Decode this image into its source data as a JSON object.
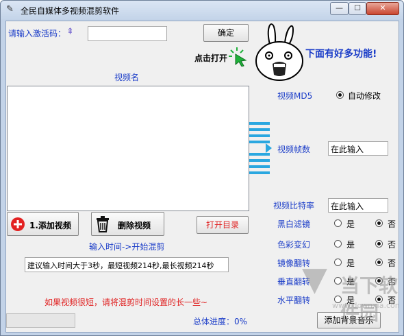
{
  "window": {
    "title": "全民自媒体多视频混剪软件",
    "min": "0",
    "max": "1",
    "close": "r"
  },
  "activation": {
    "label": "请输入激活码：",
    "value": "",
    "confirm": "确定",
    "click_hint": "点击打开"
  },
  "promo": {
    "text": "下面有好多功能!"
  },
  "video_list": {
    "header": "视频名",
    "items": []
  },
  "buttons": {
    "add_video": "1.添加视频",
    "delete_video": "删除视频",
    "open_dir": "打开目录",
    "add_music": "添加背景音乐"
  },
  "mix": {
    "time_label": "输入时间->开始混剪",
    "time_value": "建议输入时间大于3秒，最短视频214秒,最长视频214秒",
    "warning": "如果视频很短，请将混剪时间设置的长一些~",
    "progress_label": "总体进度：0%",
    "progress_percent": 0
  },
  "settings": {
    "md5_label": "视频MD5",
    "md5_option": "自动修改",
    "fps_label": "视频帧数",
    "fps_value": "在此输入",
    "bitrate_label": "视频比特率",
    "bitrate_value": "在此输入",
    "yes": "是",
    "no": "否",
    "filters": [
      {
        "label": "黑白滤镜",
        "selected": "no"
      },
      {
        "label": "色彩变幻",
        "selected": "no"
      },
      {
        "label": "镜像翻转",
        "selected": "no"
      },
      {
        "label": "垂直翻转",
        "selected": "no"
      },
      {
        "label": "水平翻转",
        "selected": "no"
      }
    ]
  },
  "watermark": {
    "brand": "当下软件园",
    "sub": "www.downxia.com"
  },
  "colors": {
    "label_blue": "#1a3cc8",
    "warning_red": "#e02020",
    "add_icon_red": "#e32222",
    "accent_bar": "#2aa7e0"
  }
}
